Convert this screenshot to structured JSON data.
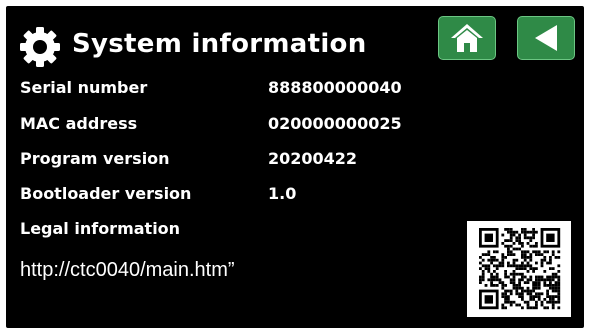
{
  "header": {
    "title": "System information",
    "icon": "gear-icon",
    "home_button_icon": "home-icon",
    "back_button_icon": "back-arrow-icon",
    "button_color": "#2f8a47"
  },
  "info": {
    "serial_label": "Serial number",
    "serial_value": "888800000040",
    "mac_label": "MAC address",
    "mac_value": "020000000025",
    "program_label": "Program version",
    "program_value": "20200422",
    "bootloader_label": "Bootloader version",
    "bootloader_value": "1.0",
    "legal_label": "Legal information"
  },
  "url": "http://ctc0040/main.htm”"
}
